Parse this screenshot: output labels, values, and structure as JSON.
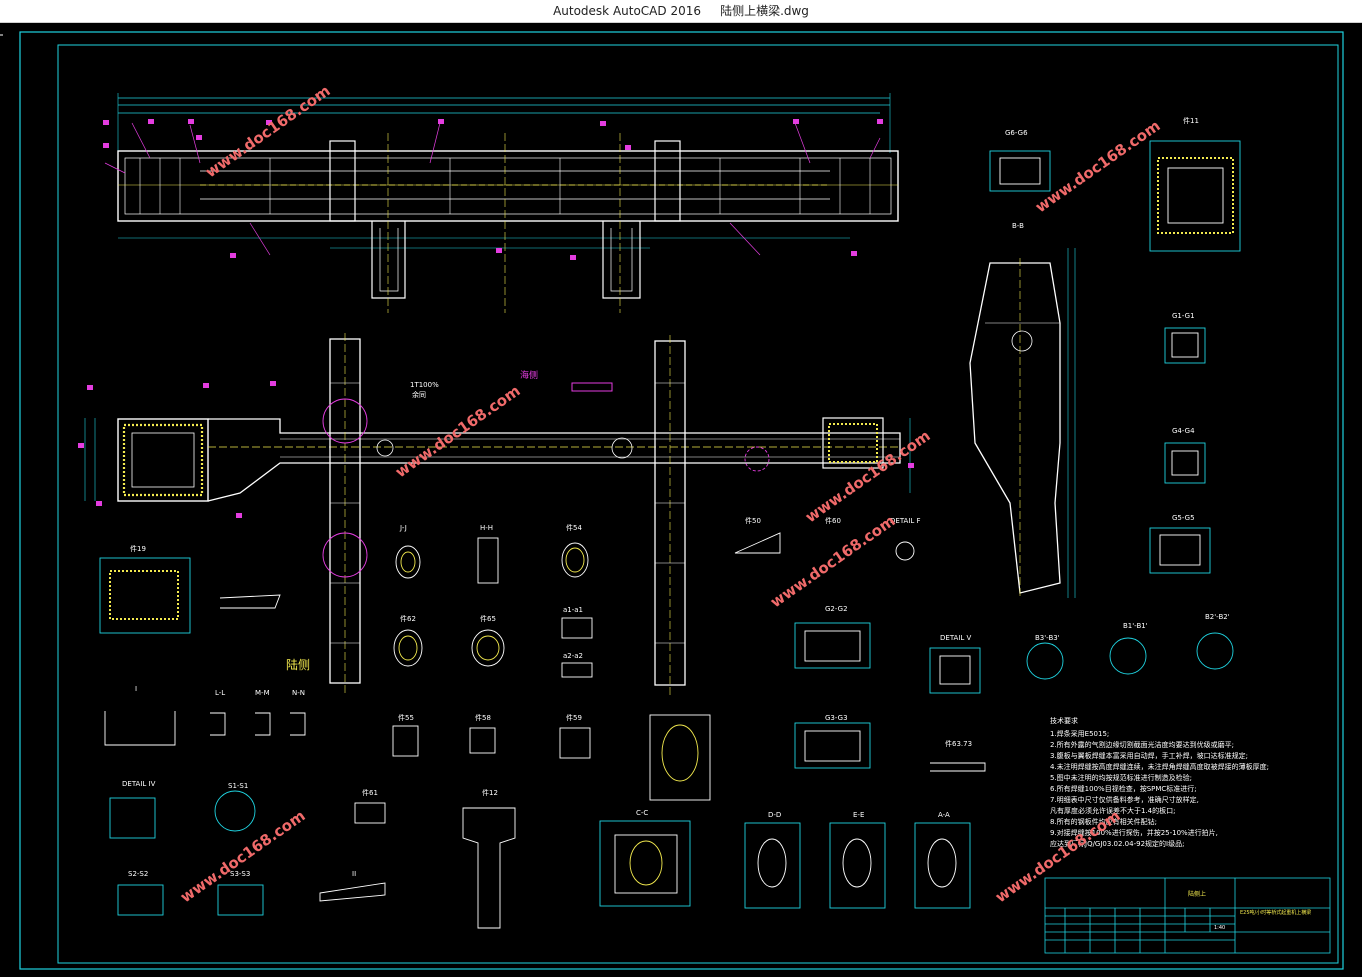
{
  "window": {
    "app": "Autodesk AutoCAD 2016",
    "file": "陆侧上横梁.dwg"
  },
  "colors": {
    "background": "#000000",
    "frame": "#1fd3e0",
    "structure": "#ffffff",
    "centerline": "#f2e94e",
    "dimension": "#1fd3e0",
    "callout": "#e43de0",
    "hatch": "#f2e94e",
    "watermark": "#f06a6a"
  },
  "watermarks": [
    "www.doc168.com",
    "www.doc168.com",
    "www.doc168.com",
    "www.doc168.com",
    "www.doc168.com",
    "www.doc168.com",
    "www.doc168.com"
  ],
  "views": {
    "section_66": "G6-G6",
    "part_11": "件11",
    "section_bb": "B-B",
    "section_g1": "G1-G1",
    "section_g4": "G4-G4",
    "section_g5": "G5-G5",
    "side_label": "海侧",
    "land_label": "陆侧",
    "weld_note": "1T100%",
    "weld_note2": "余同",
    "part_19": "件19",
    "section_jj": "J-J",
    "section_hh": "H-H",
    "part_54": "件54",
    "part_50": "件50",
    "part_60": "件60",
    "detail_f": "DETAIL F",
    "part_62": "件62",
    "part_65": "件65",
    "section_a1": "a1-a1",
    "section_a2": "a2-a2",
    "section_g2": "G2-G2",
    "detail_v": "DETAIL V",
    "section_b3": "B3'-B3'",
    "section_b1": "B1'-B1'",
    "section_b2": "B2'-B2'",
    "section_i": "I",
    "section_ll": "L-L",
    "section_mm": "M-M",
    "section_nn": "N-N",
    "part_55": "件55",
    "part_58": "件58",
    "part_59": "件59",
    "section_g3": "G3-G3",
    "part_63_73": "件63.73",
    "detail_iv": "DETAIL IV",
    "section_s1": "S1-S1",
    "part_61": "件61",
    "part_12": "件12",
    "section_cc": "C-C",
    "section_dd": "D-D",
    "section_ee": "E-E",
    "section_aa": "A-A",
    "section_s2": "S2-S2",
    "section_s3": "S3-S3",
    "section_ii": "II"
  },
  "technical_requirements": {
    "title": "技术要求",
    "lines": [
      "1.焊条采用E5015;",
      "2.所有外露的气割边缘切割截面光洁度均要达到优级或磨平;",
      "3.腹板与翼板焊缝本富采用自动焊，手工补焊，坡口达标准规定;",
      "4.未注明焊缝按高度焊缝连续，未注焊角焊缝高度取被焊接的薄板厚度;",
      "5.图中未注明的均按规范标准进行制造及检验;",
      "6.所有焊缝100%目视检查，按SPMC标准进行;",
      "7.明细表中尺寸仅供备料参考，准确尺寸放样定,",
      "  凡有厚度必须允许误差不大于1.4的板口;",
      "8.所有的钢板件均应有相关件配钻;",
      "9.对接焊缝按100%进行探伤，并按25-10%进行拍片,",
      "  应达到厂标JQ/GJ03.02.04-92规定的I级品;"
    ]
  },
  "title_block": {
    "company": "陆侧上",
    "drawing_name": "E25吨/小时等桥式起重机上横梁",
    "scale": "1:40"
  }
}
